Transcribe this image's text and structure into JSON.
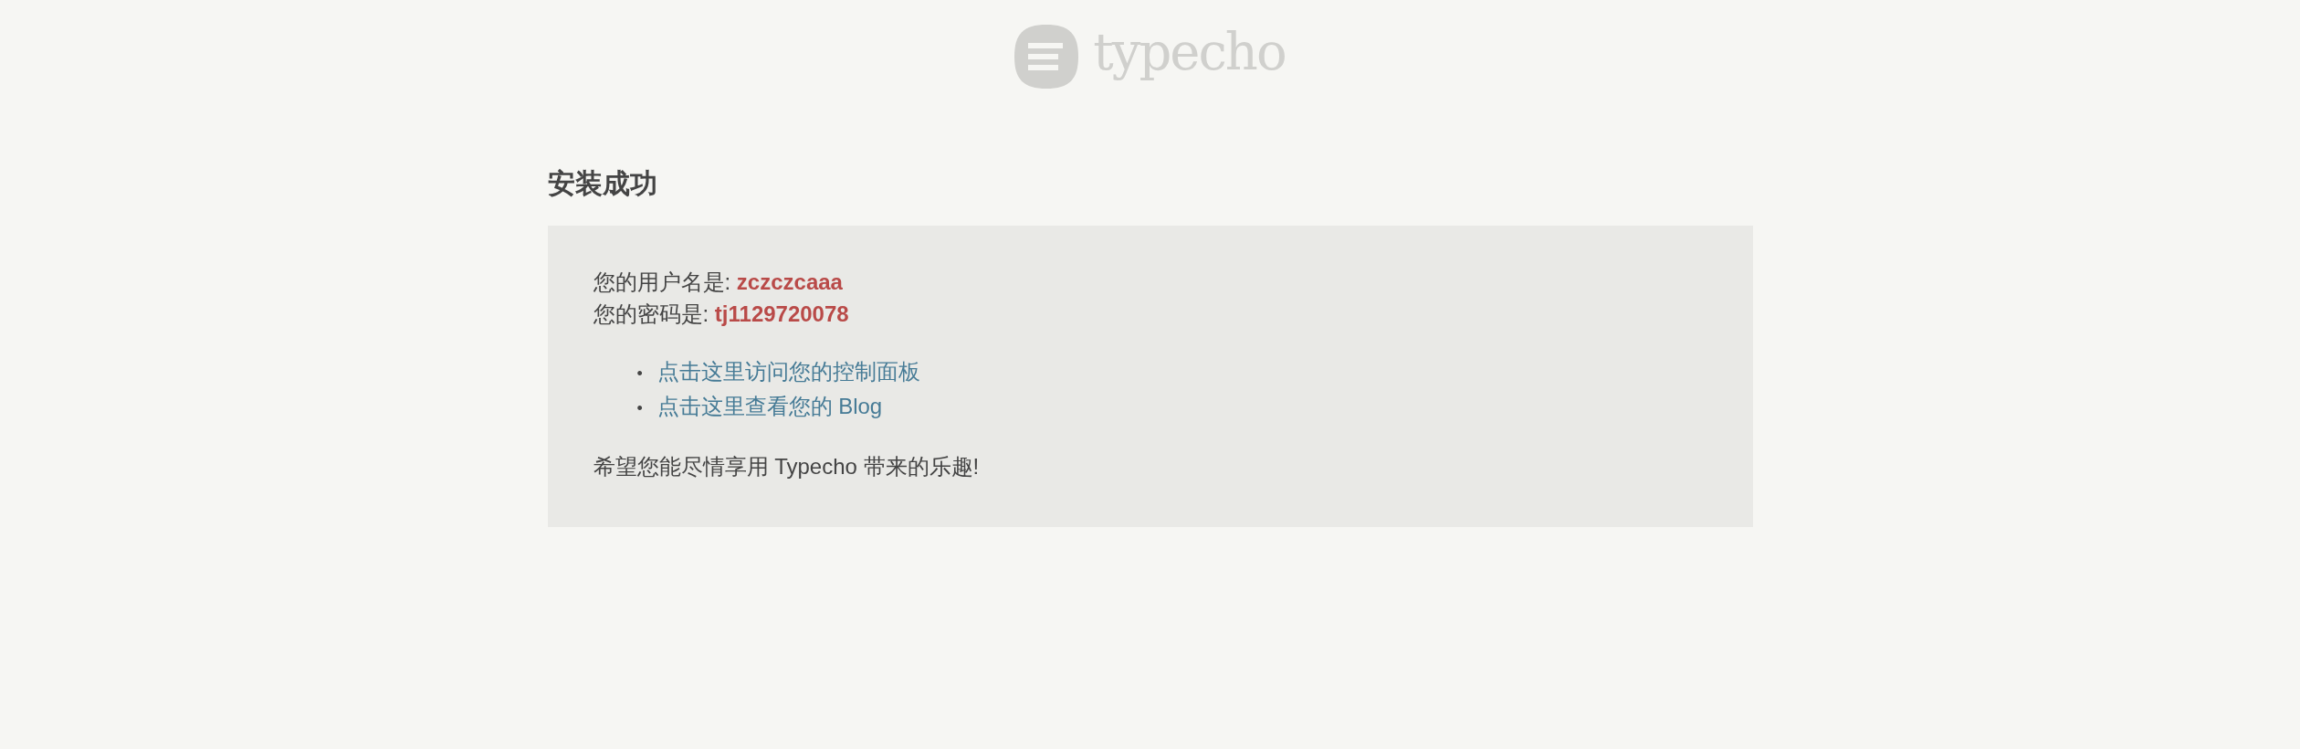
{
  "logo": {
    "text": "typecho"
  },
  "title": "安装成功",
  "credentials": [
    "您的用户名是: **zczczcaaa**",
    "您的密码是: **tj1129720078**"
  ],
  "links": [
    {
      "bullet": "•",
      "label": "点击这里访问您的控制面板"
    },
    {
      "bullet": "•",
      "label": "点击这里查看您的 Blog"
    }
  ],
  "message": "希望您能尽情享用 Typecho 带来的乐趣!"
}
